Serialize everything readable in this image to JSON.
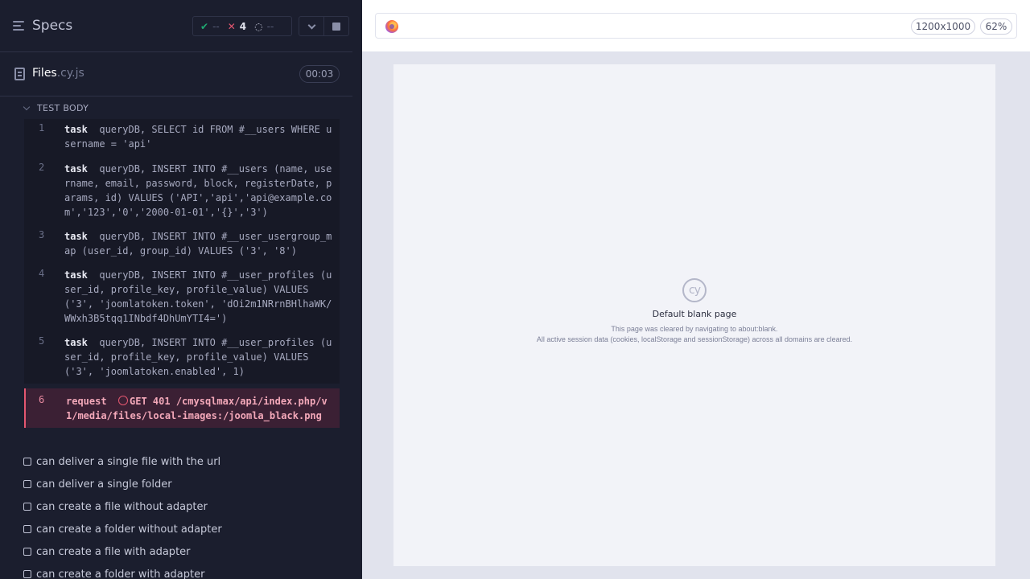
{
  "header": {
    "specs_label": "Specs",
    "stats": {
      "passed_symbol": "✔",
      "passed": "--",
      "failed_symbol": "✕",
      "failed": "4",
      "pending_symbol": "◌",
      "pending": "--"
    }
  },
  "file": {
    "name": "Files",
    "ext": ".cy.js",
    "duration": "00:03"
  },
  "test_body": {
    "label": "TEST BODY",
    "commands": [
      {
        "num": "1",
        "kw": "task",
        "text": "queryDB, SELECT id FROM #__users WHERE username = 'api'"
      },
      {
        "num": "2",
        "kw": "task",
        "text": "queryDB, INSERT INTO #__users (name, username, email, password, block, registerDate, params, id) VALUES ('API','api','api@example.com','123','0','2000-01-01','{}','3')"
      },
      {
        "num": "3",
        "kw": "task",
        "text": "queryDB, INSERT INTO #__user_usergroup_map (user_id, group_id) VALUES ('3', '8')"
      },
      {
        "num": "4",
        "kw": "task",
        "text": "queryDB, INSERT INTO #__user_profiles (user_id, profile_key, profile_value) VALUES ('3', 'joomlatoken.token', 'dOi2m1NRrnBHlhaWK/WWxh3B5tqq1INbdf4DhUmYTI4=')"
      },
      {
        "num": "5",
        "kw": "task",
        "text": "queryDB, INSERT INTO #__user_profiles (user_id, profile_key, profile_value) VALUES ('3', 'joomlatoken.enabled', 1)"
      },
      {
        "num": "6",
        "kw": "request",
        "text": "GET 401 /cmysqlmax/api/index.php/v1/media/files/local-images:/joomla_black.png"
      }
    ]
  },
  "tests": [
    "can deliver a single file with the url",
    "can deliver a single folder",
    "can create a file without adapter",
    "can create a folder without adapter",
    "can create a file with adapter",
    "can create a folder with adapter"
  ],
  "aut": {
    "viewport": "1200x1000",
    "zoom": "62%",
    "blank_title": "Default blank page",
    "blank_line1": "This page was cleared by navigating to about:blank.",
    "blank_line2": "All active session data (cookies, localStorage and sessionStorage) across all domains are cleared.",
    "logo_text": "cy"
  },
  "colors": {
    "passed": "#1fa971",
    "failed": "#e45770",
    "pending": "#8a8fa8"
  }
}
